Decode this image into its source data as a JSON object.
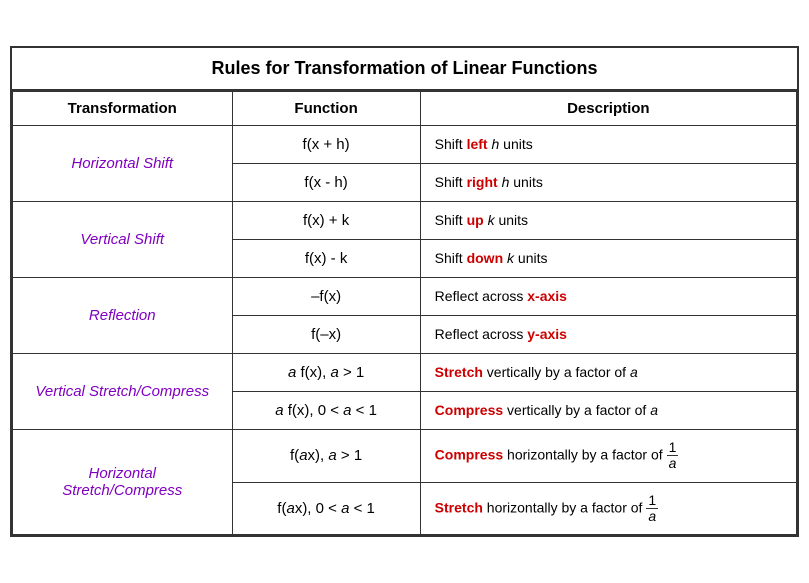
{
  "title": "Rules for Transformation of Linear Functions",
  "headers": [
    "Transformation",
    "Function",
    "Description"
  ],
  "rows": [
    {
      "transform": "Horizontal Shift",
      "rowspan": 2,
      "sub": [
        {
          "function": "f(x + h)",
          "desc_parts": [
            {
              "text": "Shift ",
              "style": ""
            },
            {
              "text": "left",
              "style": "red"
            },
            {
              "text": " ",
              "style": ""
            },
            {
              "text": "h",
              "style": "italic"
            },
            {
              "text": " units",
              "style": ""
            }
          ]
        },
        {
          "function": "f(x  - h)",
          "desc_parts": [
            {
              "text": "Shift ",
              "style": ""
            },
            {
              "text": "right",
              "style": "red"
            },
            {
              "text": " ",
              "style": ""
            },
            {
              "text": "h",
              "style": "italic"
            },
            {
              "text": " units",
              "style": ""
            }
          ]
        }
      ]
    },
    {
      "transform": "Vertical Shift",
      "rowspan": 2,
      "sub": [
        {
          "function": "f(x) + k",
          "desc_parts": [
            {
              "text": "Shift ",
              "style": ""
            },
            {
              "text": "up",
              "style": "red"
            },
            {
              "text": " ",
              "style": ""
            },
            {
              "text": "k",
              "style": "italic"
            },
            {
              "text": " units",
              "style": ""
            }
          ]
        },
        {
          "function": "f(x) - k",
          "desc_parts": [
            {
              "text": "Shift ",
              "style": ""
            },
            {
              "text": "down",
              "style": "red"
            },
            {
              "text": " ",
              "style": ""
            },
            {
              "text": "k",
              "style": "italic"
            },
            {
              "text": " units",
              "style": ""
            }
          ]
        }
      ]
    },
    {
      "transform": "Reflection",
      "rowspan": 2,
      "sub": [
        {
          "function": "–f(x)",
          "desc_parts": [
            {
              "text": "Reflect across ",
              "style": ""
            },
            {
              "text": "x-axis",
              "style": "red"
            }
          ]
        },
        {
          "function": "f(–x)",
          "desc_parts": [
            {
              "text": "Reflect across ",
              "style": ""
            },
            {
              "text": "y-axis",
              "style": "red"
            }
          ]
        }
      ]
    },
    {
      "transform": "Vertical Stretch/Compress",
      "rowspan": 2,
      "sub": [
        {
          "function": "a f(x), a > 1",
          "desc_parts": [
            {
              "text": "Stretch",
              "style": "red"
            },
            {
              "text": " vertically by a factor of ",
              "style": ""
            },
            {
              "text": "a",
              "style": "italic"
            }
          ]
        },
        {
          "function": "a f(x), 0 < a < 1",
          "function_italic_a": true,
          "desc_parts": [
            {
              "text": "Compress",
              "style": "red"
            },
            {
              "text": " vertically by a factor of ",
              "style": ""
            },
            {
              "text": "a",
              "style": "italic"
            }
          ]
        }
      ]
    },
    {
      "transform": "Horizontal Stretch/Compress",
      "rowspan": 2,
      "sub": [
        {
          "function": "f(ax), a > 1",
          "desc_type": "fraction",
          "desc_prefix_parts": [
            {
              "text": "Compress",
              "style": "red"
            },
            {
              "text": " horizontally by a factor of ",
              "style": ""
            }
          ],
          "fraction_num": "1",
          "fraction_den": "a"
        },
        {
          "function": "f(ax), 0 < a < 1",
          "desc_type": "fraction",
          "desc_prefix_parts": [
            {
              "text": "Stretch",
              "style": "red"
            },
            {
              "text": " horizontally by a factor of ",
              "style": ""
            }
          ],
          "fraction_num": "1",
          "fraction_den": "a"
        }
      ]
    }
  ]
}
